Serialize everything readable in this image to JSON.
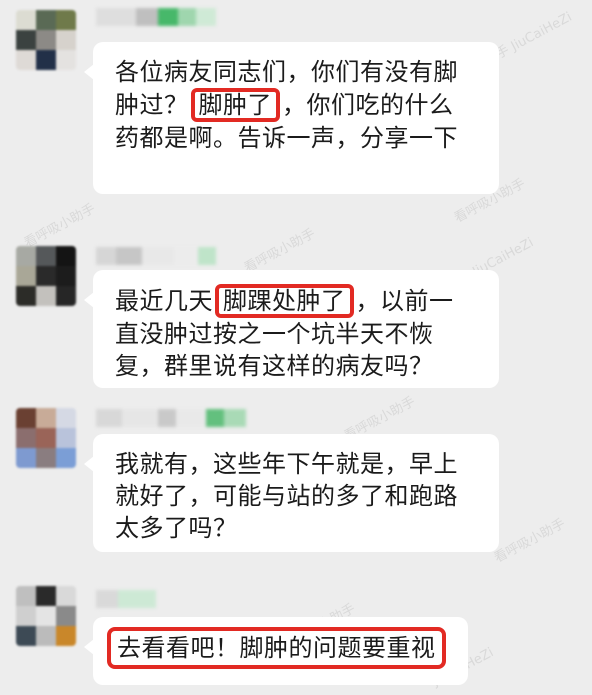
{
  "messages": [
    {
      "pre": "各位病友同志们，你们有没有脚肿过？",
      "highlight": "脚肿了",
      "post": "，你们吃的什么药都是啊。告诉一声，分享一下"
    },
    {
      "pre": "最近几天",
      "highlight": "脚踝处肿了",
      "post": "，以前一直没肿过按之一个坑半天不恢复，群里说有这样的病友吗？"
    },
    {
      "text": "我就有，这些年下午就是，早上就好了，可能与站的多了和跑路太多了吗？"
    },
    {
      "highlight": "去看看吧！脚肿的问题要重视"
    }
  ],
  "watermark": {
    "name": "看呼吸小助手",
    "handle": "JiuCaiHeZi"
  },
  "colors": {
    "background": "#ededed",
    "bubble": "#ffffff",
    "highlight_border": "#e22a23",
    "text": "#1b1b1b"
  }
}
